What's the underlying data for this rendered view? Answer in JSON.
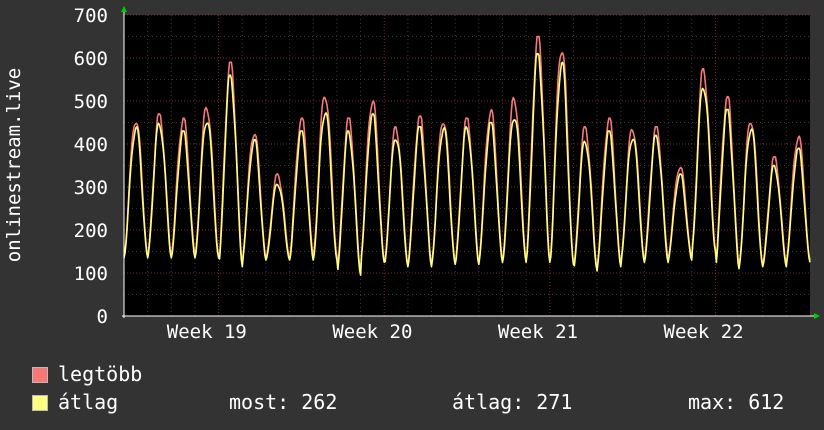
{
  "chart_data": {
    "type": "line",
    "ylabel": "onlinestream.live",
    "ylim": [
      0,
      700
    ],
    "yticks": [
      0,
      100,
      200,
      300,
      400,
      500,
      600,
      700
    ],
    "x_labels": [
      "Week 19",
      "Week 20",
      "Week 21",
      "Week 22"
    ],
    "grid": true,
    "days": 29,
    "series": [
      {
        "name": "legtöbb",
        "color": "#f87878",
        "daily_min": [
          140,
          140,
          145,
          140,
          120,
          135,
          135,
          140,
          140,
          100,
          130,
          120,
          120,
          125,
          125,
          130,
          130,
          130,
          125,
          110,
          120,
          130,
          135,
          135,
          155,
          120,
          120,
          120,
          130
        ],
        "daily_peak": [
          460,
          470,
          460,
          490,
          590,
          430,
          330,
          460,
          520,
          460,
          505,
          440,
          465,
          460,
          460,
          480,
          510,
          650,
          630,
          440,
          460,
          440,
          440,
          350,
          575,
          510,
          460,
          370,
          420
        ]
      },
      {
        "name": "átlag",
        "color": "#ffff80",
        "daily_min": [
          135,
          135,
          135,
          135,
          115,
          130,
          130,
          130,
          130,
          95,
          125,
          115,
          115,
          120,
          120,
          125,
          125,
          125,
          120,
          105,
          115,
          125,
          125,
          130,
          150,
          110,
          115,
          115,
          125
        ],
        "daily_peak": [
          440,
          450,
          430,
          460,
          560,
          410,
          310,
          430,
          480,
          430,
          470,
          420,
          440,
          440,
          440,
          450,
          470,
          610,
          590,
          410,
          430,
          420,
          420,
          330,
          540,
          480,
          440,
          350,
          390
        ]
      }
    ],
    "stats": {
      "most": "262",
      "avg": "271",
      "max": "612"
    }
  },
  "legend": {
    "series1_label": "legtöbb",
    "series2_label": "átlag",
    "most_text": "most: 262",
    "avg_text": "átlag: 271",
    "max_text": "max: 612"
  }
}
